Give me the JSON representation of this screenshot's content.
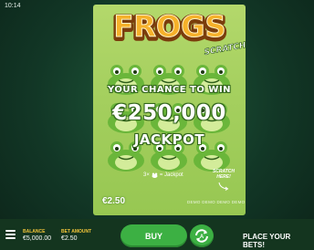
{
  "status_bar": {
    "time": "10:14"
  },
  "ticket": {
    "logo_title": "FROGS",
    "logo_subtitle": "SCRATCH",
    "headline": "YOUR CHANCE TO WIN",
    "prize_amount": "€250,000",
    "prize_label": "JACKPOT",
    "rule_multiplier": "3×",
    "rule_result": "= Jackpot",
    "scratch_hint_line1": "SCRATCH",
    "scratch_hint_line2": "HERE!",
    "price": "€2.50",
    "demo_watermark": "DEMO DEMO DEMO DEMO"
  },
  "bottom_bar": {
    "balance_label": "BALANCE",
    "balance_value": "€5,000.00",
    "bet_label": "BET AMOUNT",
    "bet_value": "€2.50",
    "buy_label": "BUY",
    "autoplay_icon": "autoplay-icon",
    "message": "PLACE YOUR BETS!"
  },
  "colors": {
    "background": "#123726",
    "card": "#a4cf5e",
    "logo_fill": "#f5a623",
    "accent_green": "#3cb043",
    "label_yellow": "#f3c53a"
  }
}
